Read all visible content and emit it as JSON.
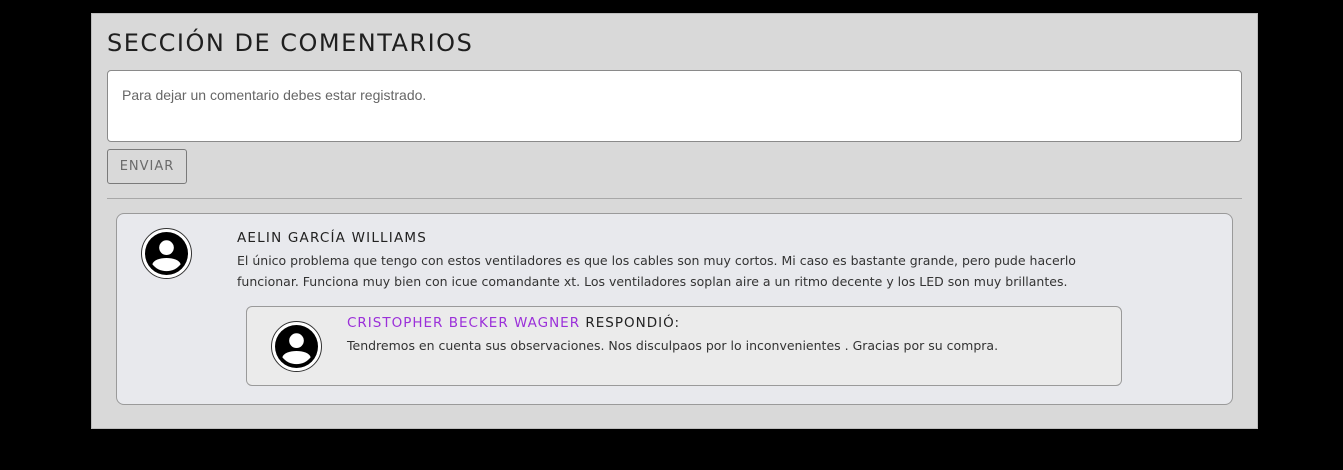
{
  "section": {
    "title": "SECCIÓN DE COMENTARIOS"
  },
  "form": {
    "comment_placeholder": "Para dejar un comentario debes estar registrado.",
    "comment_value": "",
    "send_label": "ENVIAR"
  },
  "comments": [
    {
      "author": "AELIN GARCÍA WILLIAMS",
      "avatar_icon": "user-circle-icon",
      "text": "El único problema que tengo con estos ventiladores es que los cables son muy cortos. Mi caso es bastante grande, pero pude hacerlo funcionar. Funciona muy bien con icue comandante xt. Los ventiladores soplan aire a un ritmo decente y los LED son muy brillantes.",
      "reply": {
        "author": "CRISTOPHER BECKER WAGNER",
        "verb": " RESPONDIÓ:",
        "avatar_icon": "user-circle-icon",
        "text": "Tendremos en cuenta sus observaciones. Nos disculpaos por lo inconvenientes . Gracias por su compra."
      }
    }
  ],
  "colors": {
    "page_background": "#000000",
    "section_background": "#d9d9d9",
    "comment_card_background": "#e8e9ed",
    "reply_card_background": "#ebebeb",
    "reply_author_accent": "#9b30d9"
  }
}
